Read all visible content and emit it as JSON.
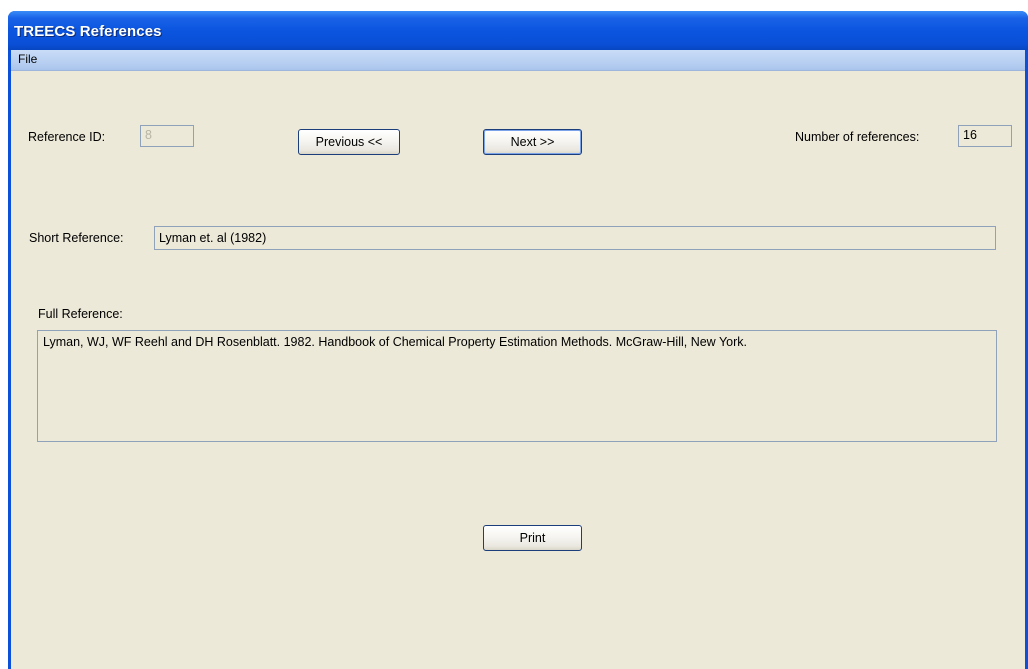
{
  "window": {
    "title": "TREECS References"
  },
  "menu": {
    "file": "File"
  },
  "form": {
    "reference_id_label": "Reference ID:",
    "reference_id_value": "8",
    "previous_label": "Previous <<",
    "next_label": "Next >>",
    "num_refs_label": "Number of references:",
    "num_refs_value": "16",
    "short_ref_label": "Short Reference:",
    "short_ref_value": "Lyman et. al (1982)",
    "full_ref_label": "Full Reference:",
    "full_ref_value": "Lyman, WJ, WF Reehl and DH Rosenblatt.  1982.  Handbook of Chemical Property Estimation Methods.  McGraw-Hill, New York.",
    "print_label": "Print"
  }
}
